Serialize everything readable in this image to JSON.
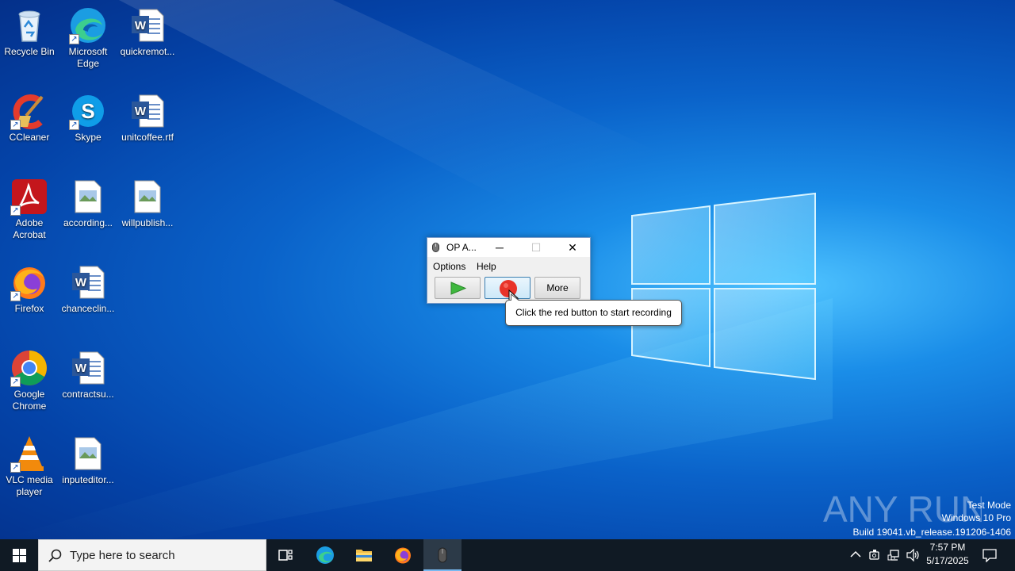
{
  "desktop": {
    "icons": [
      {
        "label": "Recycle Bin",
        "icon": "recycle-bin-icon"
      },
      {
        "label": "Microsoft Edge",
        "icon": "edge-icon"
      },
      {
        "label": "quickremot...",
        "icon": "word-doc-icon"
      },
      {
        "label": "CCleaner",
        "icon": "ccleaner-icon"
      },
      {
        "label": "Skype",
        "icon": "skype-icon"
      },
      {
        "label": "unitcoffee.rtf",
        "icon": "word-doc-icon"
      },
      {
        "label": "Adobe Acrobat",
        "icon": "acrobat-icon"
      },
      {
        "label": "according...",
        "icon": "image-file-icon"
      },
      {
        "label": "willpublish...",
        "icon": "image-file-icon"
      },
      {
        "label": "Firefox",
        "icon": "firefox-icon"
      },
      {
        "label": "chanceclin...",
        "icon": "word-doc-icon"
      },
      {
        "label": "Google Chrome",
        "icon": "chrome-icon"
      },
      {
        "label": "contractsu...",
        "icon": "word-doc-icon"
      },
      {
        "label": "VLC media player",
        "icon": "vlc-icon"
      },
      {
        "label": "inputeditor...",
        "icon": "image-file-icon"
      }
    ]
  },
  "app_window": {
    "title": "OP A...",
    "menu": [
      "Options",
      "Help"
    ],
    "more_label": "More",
    "play_color": "#3fb83f",
    "record_color": "#e8332a"
  },
  "tooltip": {
    "text": "Click the red button to start recording"
  },
  "watermark": {
    "brand": "ANY RUN",
    "line1": "Test Mode",
    "line2": "Windows 10 Pro",
    "line3": "Build 19041.vb_release.191206-1406"
  },
  "taskbar": {
    "search_placeholder": "Type here to search",
    "time": "7:57 PM",
    "date": "5/17/2025",
    "accent_color": "#78b8f0"
  }
}
